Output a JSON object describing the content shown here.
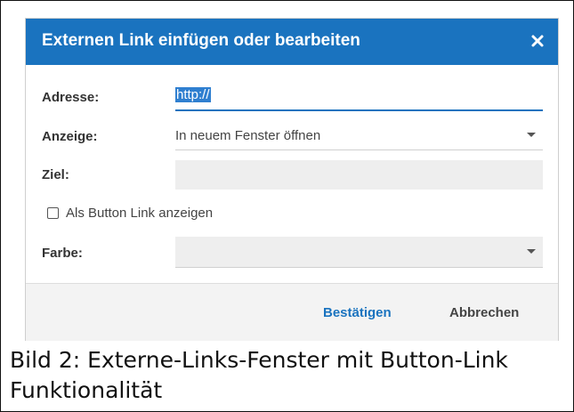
{
  "dialog": {
    "title": "Externen Link einfügen oder bearbeiten",
    "close_icon": "close-icon",
    "accent_color": "#1a73bf",
    "fields": {
      "address": {
        "label": "Adresse:",
        "value": "http://"
      },
      "display": {
        "label": "Anzeige:",
        "value": "In neuem Fenster öffnen"
      },
      "target": {
        "label": "Ziel:",
        "value": ""
      },
      "button_link": {
        "label": "Als Button Link anzeigen",
        "checked": false
      },
      "color": {
        "label": "Farbe:",
        "value": ""
      }
    },
    "footer": {
      "confirm_label": "Bestätigen",
      "cancel_label": "Abbrechen"
    }
  },
  "caption": {
    "text": "Bild 2: Externe-Links-Fenster mit Button-Link Funktionalität"
  }
}
